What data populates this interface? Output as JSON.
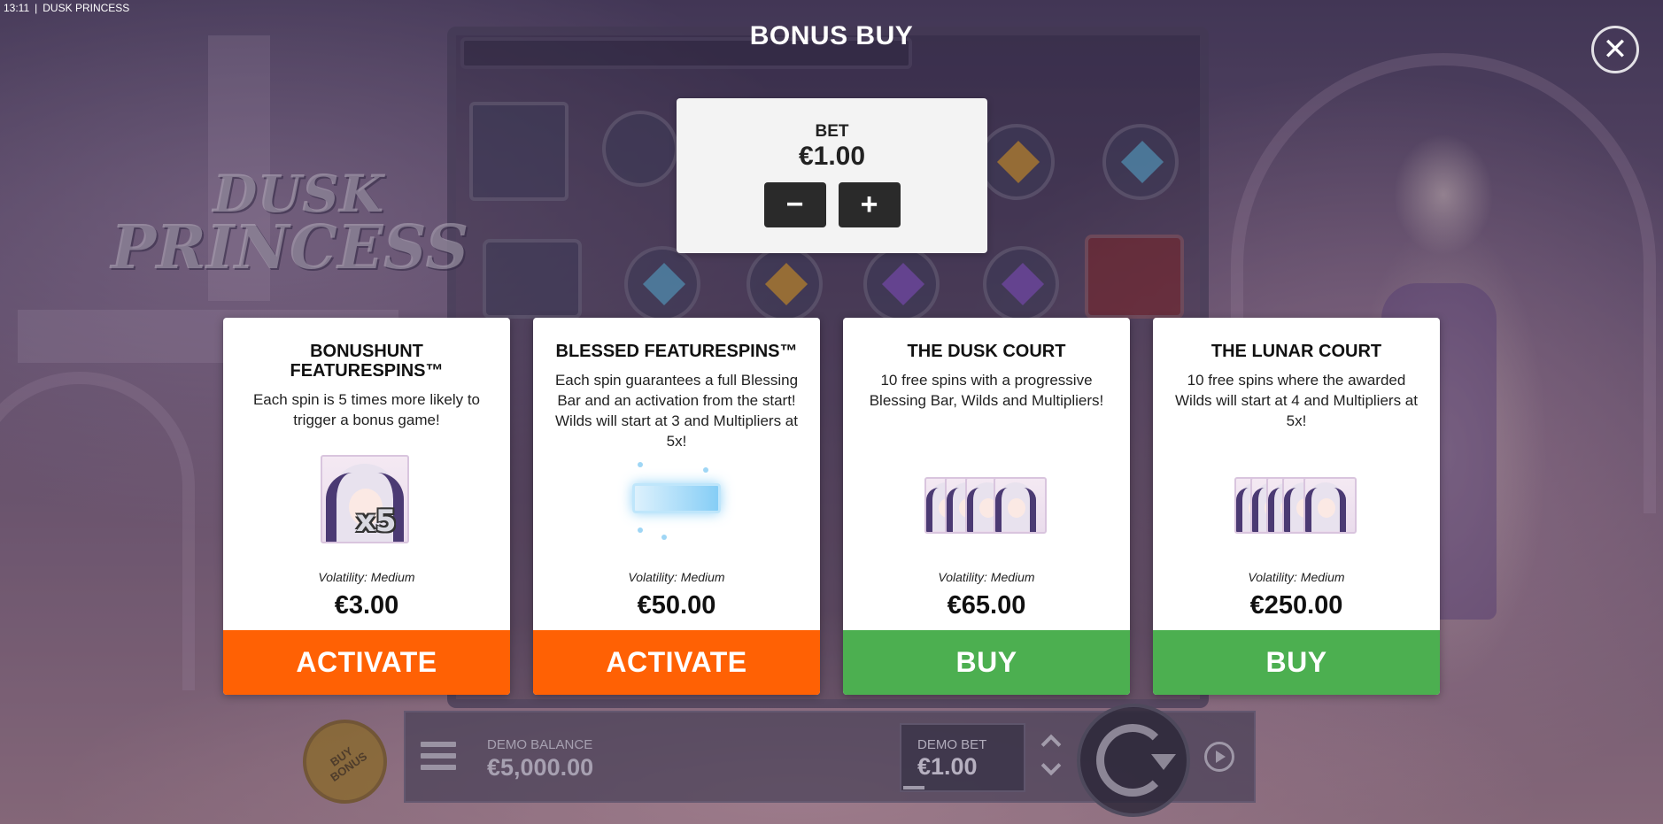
{
  "status": {
    "time": "13:11",
    "separator": "|",
    "game_name": "DUSK PRINCESS"
  },
  "logo": {
    "line1": "DUSK",
    "line2": "PRINCESS"
  },
  "header": {
    "title": "BONUS BUY",
    "close_icon": "close-icon"
  },
  "bet": {
    "label": "BET",
    "value": "€1.00",
    "decrease": "−",
    "increase": "+"
  },
  "offers": [
    {
      "title": "BONUSHUNT FEATURESPINS™",
      "description": "Each spin is 5 times more likely to trigger a bonus game!",
      "image_badge": "x5",
      "volatility": "Volatility: Medium",
      "price": "€3.00",
      "action": "ACTIVATE",
      "action_color": "#ff6104"
    },
    {
      "title": "BLESSED FEATURESPINS™",
      "description": "Each spin guarantees a full Blessing Bar and an activation from the start! Wilds will start at 3 and Multipliers at 5x!",
      "volatility": "Volatility: Medium",
      "price": "€50.00",
      "action": "ACTIVATE",
      "action_color": "#ff6104"
    },
    {
      "title": "THE DUSK COURT",
      "description": "10 free spins with a progressive Blessing Bar, Wilds and Multipliers!",
      "volatility": "Volatility: Medium",
      "price": "€65.00",
      "action": "BUY",
      "action_color": "#4caf50"
    },
    {
      "title": "THE LUNAR COURT",
      "description": "10 free spins where the awarded Wilds will start at 4 and Multipliers at 5x!",
      "volatility": "Volatility: Medium",
      "price": "€250.00",
      "action": "BUY",
      "action_color": "#4caf50"
    }
  ],
  "bottom_bar": {
    "buy_bonus": "BUY BONUS",
    "demo_balance_label": "DEMO BALANCE",
    "demo_balance_value": "€5,000.00",
    "demo_bet_label": "DEMO BET",
    "demo_bet_value": "€1.00"
  }
}
